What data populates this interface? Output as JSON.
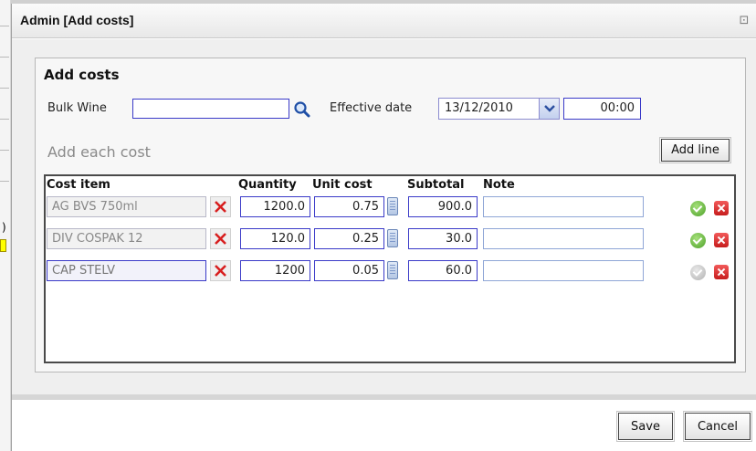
{
  "dialog": {
    "title": "Admin [Add costs]"
  },
  "panel": {
    "title": "Add costs",
    "bulk_wine_label": "Bulk Wine",
    "bulk_wine_value": "",
    "effective_date_label": "Effective date",
    "effective_date_value": "13/12/2010",
    "time_value": "00:00",
    "section_title": "Add each cost",
    "add_line_label": "Add line"
  },
  "grid": {
    "columns": [
      "Cost item",
      "Quantity",
      "Unit cost",
      "Subtotal",
      "Note"
    ],
    "rows": [
      {
        "cost_item": "AG BVS 750ml",
        "quantity": "1200.0",
        "unit_cost": "0.75",
        "subtotal": "900.0",
        "note": "",
        "confirmed": true
      },
      {
        "cost_item": "DIV COSPAK 12",
        "quantity": "120.0",
        "unit_cost": "0.25",
        "subtotal": "30.0",
        "note": "",
        "confirmed": true
      },
      {
        "cost_item": "CAP STELV",
        "quantity": "1200",
        "unit_cost": "0.05",
        "subtotal": "60.0",
        "note": "",
        "confirmed": false
      }
    ]
  },
  "footer": {
    "save_label": "Save",
    "cancel_label": "Cancel"
  },
  "icons": {
    "search": "search-icon",
    "dropdown": "chevron-down-icon",
    "delete": "close-icon",
    "calculator": "calculator-icon",
    "confirm": "check-circle-icon",
    "remove": "remove-icon",
    "dialog_close": "close-icon"
  },
  "colors": {
    "field_border": "#3a3ac8",
    "remove": "#d63030",
    "confirm": "#5bb032"
  }
}
